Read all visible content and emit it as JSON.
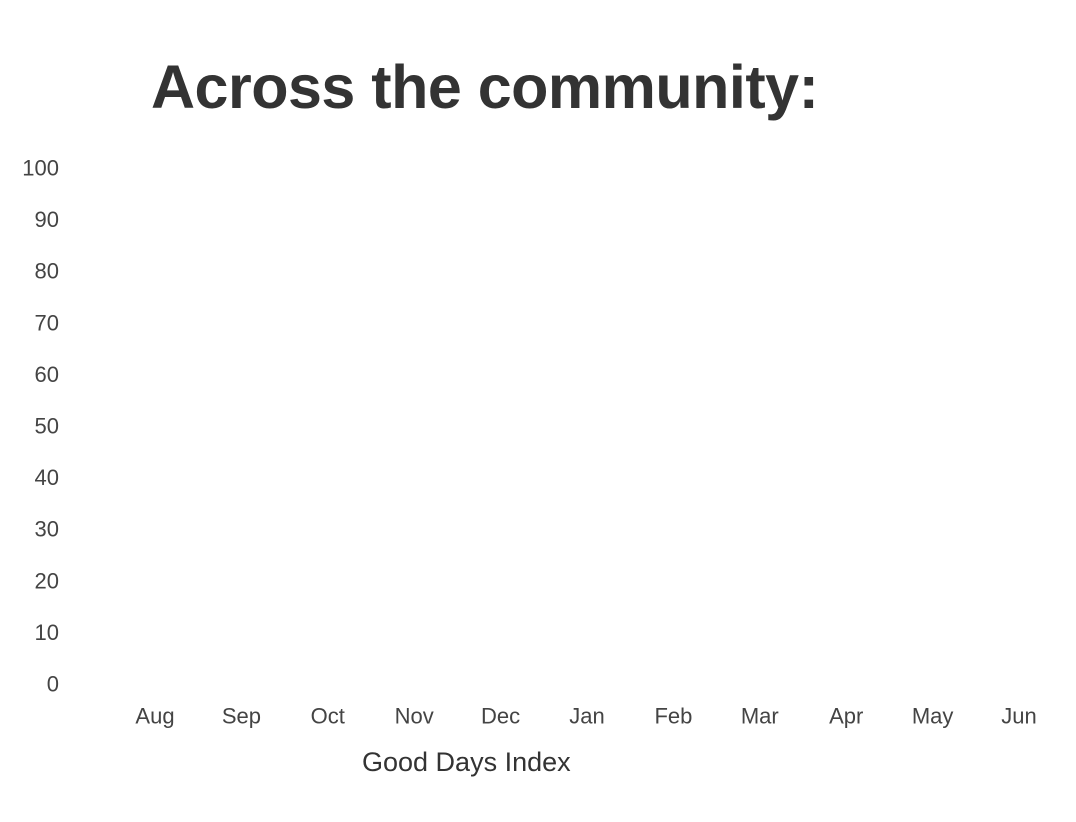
{
  "header": {
    "title": "Across the community:"
  },
  "chart_data": {
    "type": "line",
    "title": "Across the community:",
    "xlabel": "",
    "ylabel": "",
    "categories": [
      "Aug",
      "Sep",
      "Oct",
      "Nov",
      "Dec",
      "Jan",
      "Feb",
      "Mar",
      "Apr",
      "May",
      "Jun"
    ],
    "series": [
      {
        "name": "Good Days Index",
        "values": []
      }
    ],
    "ylim": [
      0,
      100
    ],
    "yticks": [
      0,
      10,
      20,
      30,
      40,
      50,
      60,
      70,
      80,
      90,
      100
    ],
    "grid": false,
    "legend_position": "bottom",
    "colors": {
      "text": "#333333",
      "tick": "#444444"
    }
  }
}
